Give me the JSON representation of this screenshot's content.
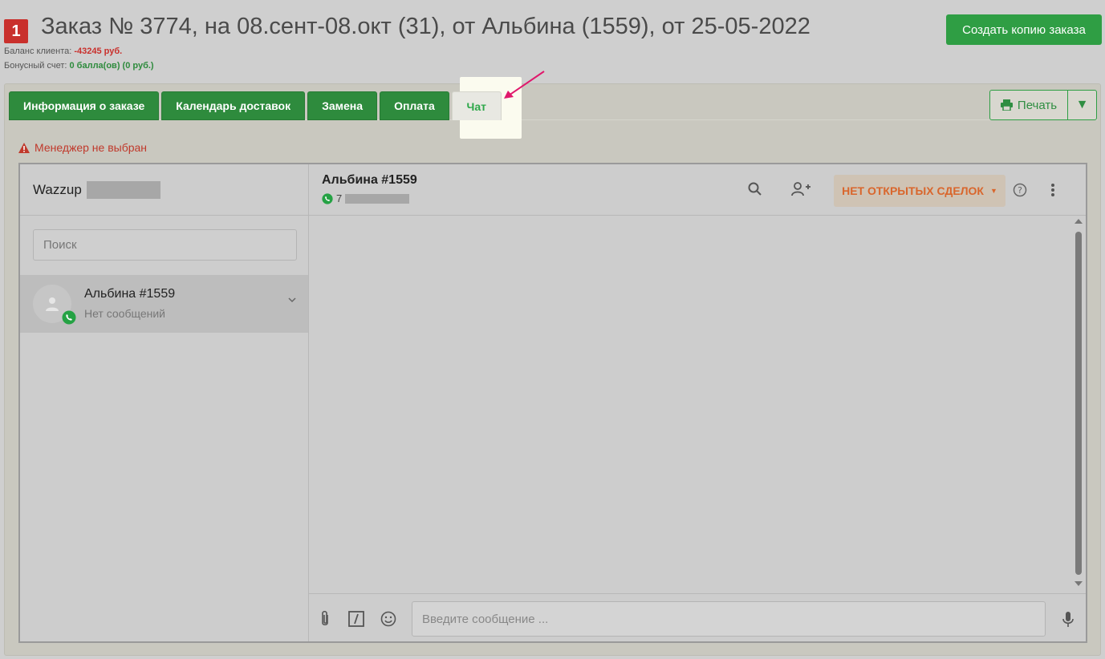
{
  "header": {
    "order_badge": "1",
    "title": "Заказ № 3774, на 08.сент-08.окт (31), от Альбина (1559), от 25-05-2022",
    "balance_label": "Баланс клиента:",
    "balance_value": "-43245 руб.",
    "bonus_label": "Бонусный счет:",
    "bonus_value": "0 балла(ов) (0 руб.)",
    "copy_button": "Создать копию заказа"
  },
  "tabs": [
    {
      "label": "Информация о заказе"
    },
    {
      "label": "Календарь доставок"
    },
    {
      "label": "Замена"
    },
    {
      "label": "Оплата"
    },
    {
      "label": "Чат",
      "active": true
    }
  ],
  "print": {
    "label": "Печать"
  },
  "warning": "Менеджер не выбран",
  "chat": {
    "channel_name": "Wazzup",
    "search_placeholder": "Поиск",
    "contact": {
      "name": "Альбина #1559",
      "preview": "Нет сообщений"
    },
    "header": {
      "name": "Альбина #1559",
      "phone_prefix": "7"
    },
    "deals_button": "НЕТ ОТКРЫТЫХ СДЕЛОК",
    "message_placeholder": "Введите сообщение ..."
  },
  "colors": {
    "accent_green": "#2e8b3d",
    "danger": "#c9302c",
    "deals_orange": "#d9662c",
    "whatsapp": "#25a244"
  }
}
